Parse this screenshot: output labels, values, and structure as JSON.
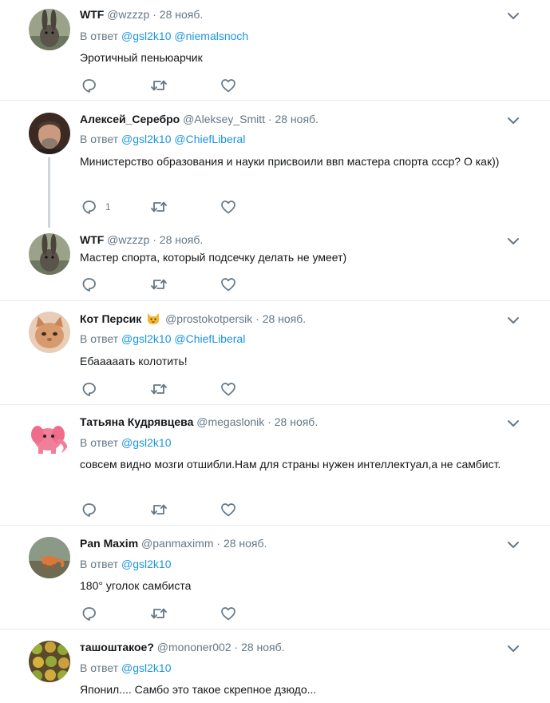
{
  "reply_prefix": "В ответ",
  "tweets": [
    {
      "name": "WTF",
      "handle": "@wzzzp",
      "dot": "·",
      "time": "28 нояб.",
      "reply_to": [
        "@gsl2k10",
        "@niemalsnoch"
      ],
      "text": "Эротичный пеньюарчик",
      "reply_count": ""
    },
    {
      "name": "Алексей_Серебро",
      "handle": "@Aleksey_Smitt",
      "dot": "·",
      "time": "28 нояб.",
      "reply_to": [
        "@gsl2k10",
        "@ChiefLiberal"
      ],
      "text": "Министерство образования и науки присвоили ввп мастера спорта ссср? О как))",
      "reply_count": "1"
    },
    {
      "name": "WTF",
      "handle": "@wzzzp",
      "dot": "·",
      "time": "28 нояб.",
      "reply_to": [],
      "text": "Мастер спорта, который подсечку делать не умеет)",
      "reply_count": ""
    },
    {
      "name": "Кот Персик",
      "handle": "@prostokotpersik",
      "dot": "·",
      "time": "28 нояб.",
      "reply_to": [
        "@gsl2k10",
        "@ChiefLiberal"
      ],
      "text": "Ебааааать колотить!",
      "reply_count": ""
    },
    {
      "name": "Татьяна Кудрявцева",
      "handle": "@megaslonik",
      "dot": "·",
      "time": "28 нояб.",
      "reply_to": [
        "@gsl2k10"
      ],
      "text": "совсем видно мозги отшибли.Нам для страны нужен интеллектуал,а не самбист.",
      "reply_count": ""
    },
    {
      "name": "Pan Maxim",
      "handle": "@panmaximm",
      "dot": "·",
      "time": "28 нояб.",
      "reply_to": [
        "@gsl2k10"
      ],
      "text": "180° уголок самбиста",
      "reply_count": ""
    },
    {
      "name": "ташоштакое?",
      "handle": "@mononer002",
      "dot": "·",
      "time": "28 нояб.",
      "reply_to": [
        "@gsl2k10"
      ],
      "text": "Японил.... Самбо это такое скрепное дзюдо...",
      "reply_count": ""
    }
  ],
  "colors": {
    "link": "#1b95e0",
    "secondary": "#657786",
    "divider": "#e6ecf0",
    "thread_line": "#ccd6dd"
  },
  "icons": {
    "reply": "reply-icon",
    "retweet": "retweet-icon",
    "like": "heart-icon",
    "menu": "chevron-down-icon",
    "name_badge": "cat-emoji-icon"
  }
}
